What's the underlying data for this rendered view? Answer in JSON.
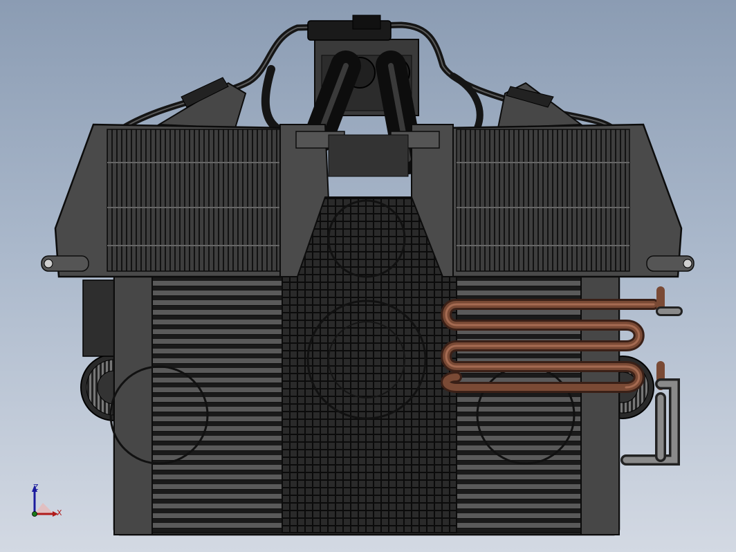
{
  "viewport": {
    "background_top": "#8b9cb3",
    "background_bottom": "#d3d9e3"
  },
  "model": {
    "body_color": "#3f3f3f",
    "dark_color": "#1d1d1d",
    "edge_color": "#0c0c0c",
    "copper_color": "#7a4a35"
  },
  "triad": {
    "z_label": "Z",
    "x_label": "X",
    "z_color": "#1b1b9e",
    "x_color": "#b01a1a"
  }
}
